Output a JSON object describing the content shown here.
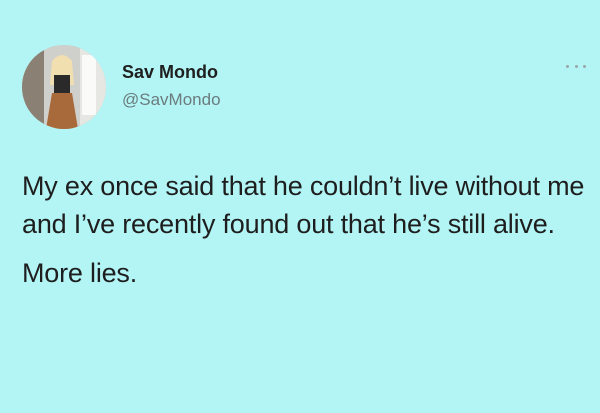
{
  "author": {
    "display_name": "Sav Mondo",
    "handle": "@SavMondo",
    "avatar_icon": "profile-photo"
  },
  "menu": {
    "icon": "more-horizontal-icon"
  },
  "tweet": {
    "paragraphs": [
      "My ex once said that he couldn’t live without me and I’ve recently found out that he’s still alive.",
      "More lies."
    ]
  },
  "colors": {
    "background": "#b3f5f5",
    "text": "#1e1e1e",
    "handle": "#6b7b7e"
  }
}
